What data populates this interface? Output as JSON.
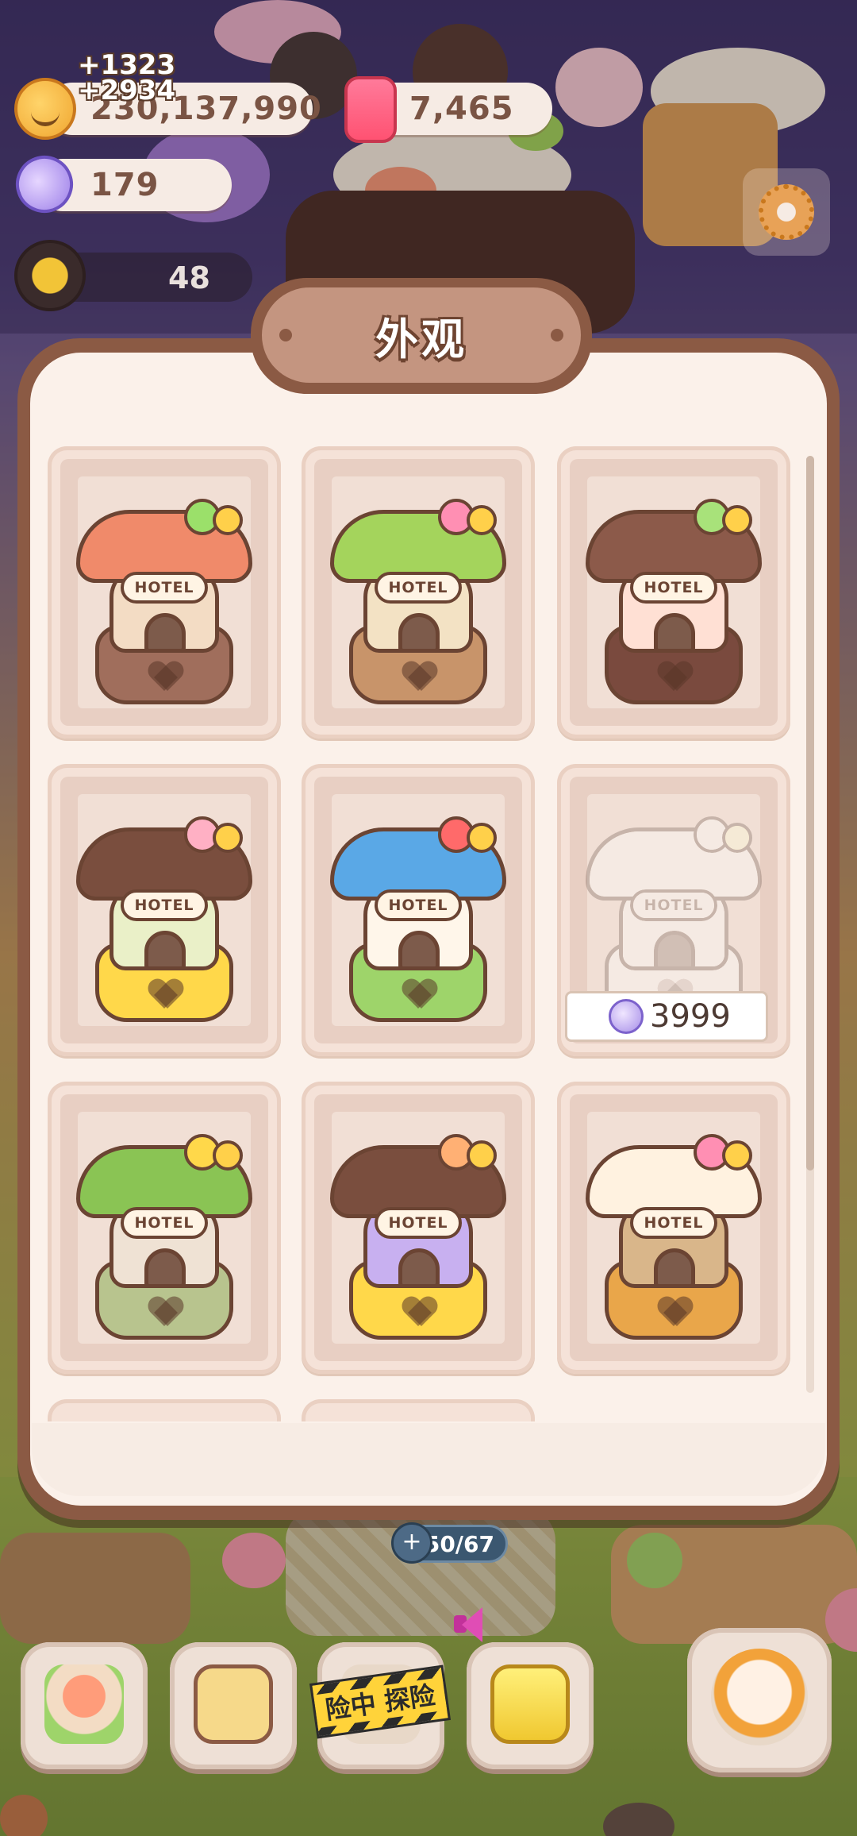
{
  "currency": {
    "coins": "230,137,990",
    "coins_gain_1": "+1323",
    "coins_gain_2": "+2934",
    "candles": "7,465",
    "candy": "179"
  },
  "player": {
    "level_count": "48"
  },
  "modal": {
    "title": "外观"
  },
  "skins": [
    {
      "sign": "HOTEL",
      "roof": "#f08a6a",
      "body": "#f3dcc4",
      "base": "#a06e5c",
      "deco": "#9be06a",
      "locked": false
    },
    {
      "sign": "HOTEL",
      "roof": "#a4d45c",
      "body": "#f3e2c4",
      "base": "#c8946a",
      "deco": "#ff8fb3",
      "locked": false
    },
    {
      "sign": "HOTEL",
      "roof": "#8c5a4a",
      "body": "#ffe0d4",
      "base": "#7a4a3e",
      "deco": "#a8e27a",
      "locked": false
    },
    {
      "sign": "HOTEL",
      "roof": "#7a4e3e",
      "body": "#eaf0c8",
      "base": "#ffd84a",
      "deco": "#ffb0c4",
      "locked": false
    },
    {
      "sign": "HOTEL",
      "roof": "#5aa8e6",
      "body": "#fff6ea",
      "base": "#9ed46a",
      "deco": "#ff6a6a",
      "locked": false
    },
    {
      "sign": "HOTEL",
      "roof": "#e9f2d8",
      "body": "#ffffff",
      "base": "#f2f2e8",
      "deco": "#ffffff",
      "locked": true,
      "price": "3999"
    },
    {
      "sign": "HOTEL",
      "roof": "#8ac454",
      "body": "#efe2d4",
      "base": "#b8c48e",
      "deco": "#ffd84a",
      "locked": false
    },
    {
      "sign": "HOTEL",
      "roof": "#7a4e3e",
      "body": "#c8b0f0",
      "base": "#ffd84a",
      "deco": "#ffb074",
      "locked": false
    },
    {
      "sign": "HOTEL",
      "roof": "#fff2e0",
      "body": "#d9b68a",
      "base": "#e9a64a",
      "deco": "#ff8fb3",
      "locked": false
    }
  ],
  "bottom": {
    "energy": "50/67",
    "explore_label": "险中 探险"
  },
  "icons": {
    "coin": "coin-icon",
    "candle": "candle-icon",
    "candy": "candy-icon",
    "gear": "gear-icon",
    "energy": "lightning-icon",
    "sound": "megaphone-icon"
  }
}
